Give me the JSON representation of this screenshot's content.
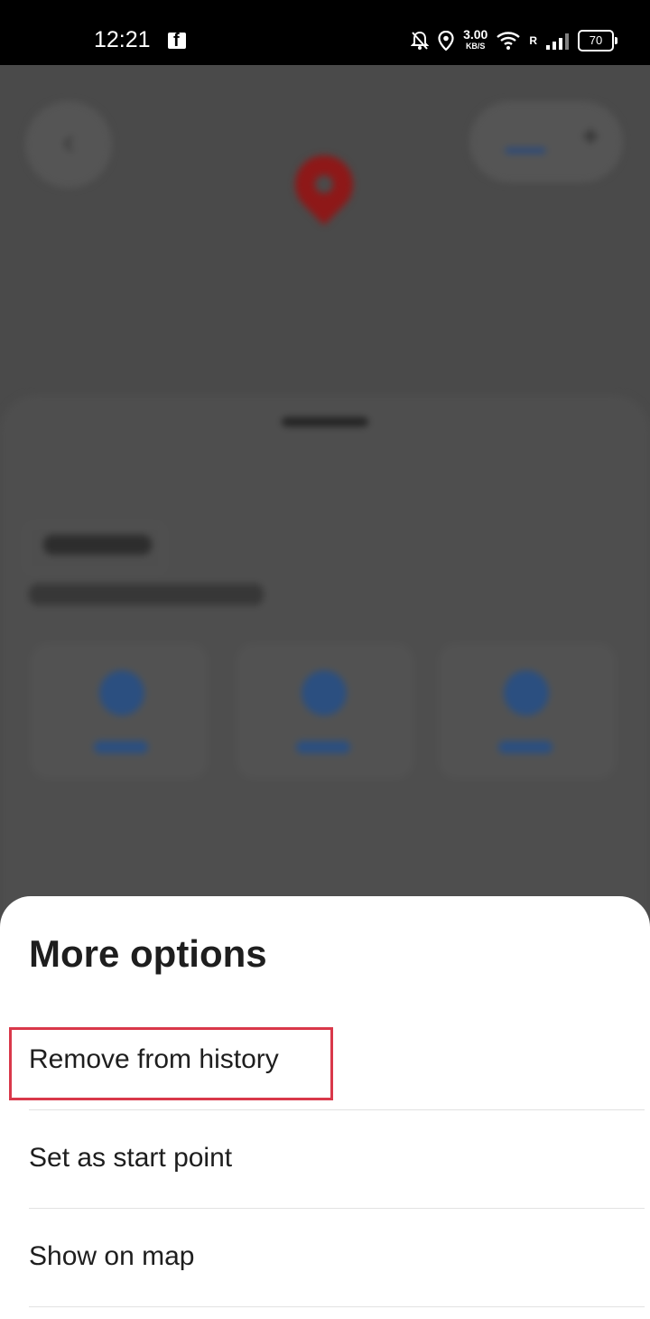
{
  "status_bar": {
    "time": "12:21",
    "net_speed": "3.00",
    "net_unit": "KB/S",
    "roaming": "R",
    "battery": "70",
    "icons": [
      "facebook-icon",
      "dnd-bell-icon",
      "location-icon",
      "wifi-icon",
      "signal-icon",
      "battery-icon"
    ]
  },
  "sheet": {
    "title": "More options",
    "options": [
      {
        "label": "Remove from history",
        "highlighted": true
      },
      {
        "label": "Set as start point"
      },
      {
        "label": "Show on map"
      }
    ]
  },
  "colors": {
    "highlight_border": "#d9384a",
    "overlay": "#4a4a4a",
    "sheet_bg": "#ffffff"
  }
}
